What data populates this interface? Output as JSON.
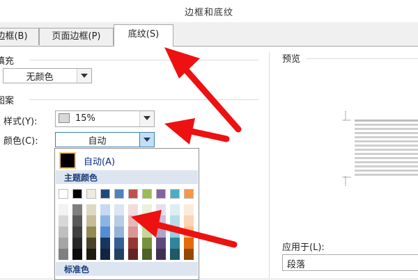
{
  "window": {
    "title": "边框和底纹"
  },
  "tabs": [
    {
      "label": "边框(B)"
    },
    {
      "label": "页面边框(P)"
    },
    {
      "label": "底纹(S)"
    }
  ],
  "fill": {
    "label": "填充",
    "value": "无颜色"
  },
  "pattern": {
    "label": "图案",
    "style_label": "样式(Y):",
    "style_value": "15%",
    "color_label": "颜色(C):",
    "color_value": "自动"
  },
  "color_popup": {
    "auto_label": "自动(A)",
    "theme_label": "主题颜色",
    "standard_label": "标准色",
    "theme_colors": [
      "#ffffff",
      "#000000",
      "#eeece1",
      "#1f497d",
      "#4f81bd",
      "#c0504d",
      "#9bbb59",
      "#8064a2",
      "#4bacc6",
      "#f79646"
    ],
    "theme_shades": [
      [
        "#f2f2f2",
        "#d8d8d8",
        "#bfbfbf",
        "#a5a5a5",
        "#7f7f7f"
      ],
      [
        "#7f7f7f",
        "#595959",
        "#3f3f3f",
        "#262626",
        "#0c0c0c"
      ],
      [
        "#ddd9c3",
        "#c4bd97",
        "#938953",
        "#494429",
        "#1d1b10"
      ],
      [
        "#c6d9f0",
        "#8db3e2",
        "#548dd4",
        "#17365d",
        "#0f243e"
      ],
      [
        "#dbe5f1",
        "#b8cce4",
        "#95b3d7",
        "#366092",
        "#244061"
      ],
      [
        "#f2dcdb",
        "#e5b9b7",
        "#d99694",
        "#953734",
        "#632423"
      ],
      [
        "#ebf1dd",
        "#d7e3bc",
        "#c3d69b",
        "#76923c",
        "#4f6128"
      ],
      [
        "#e5e0ec",
        "#ccc1d9",
        "#b2a2c7",
        "#5f497a",
        "#3f3151"
      ],
      [
        "#dbeef3",
        "#b7dde8",
        "#92cddc",
        "#31859b",
        "#205867"
      ],
      [
        "#fdeada",
        "#fbd5b5",
        "#fac08f",
        "#e36c09",
        "#974806"
      ]
    ]
  },
  "preview": {
    "label": "预览"
  },
  "apply": {
    "label": "应用于(L):",
    "value": "段落"
  }
}
